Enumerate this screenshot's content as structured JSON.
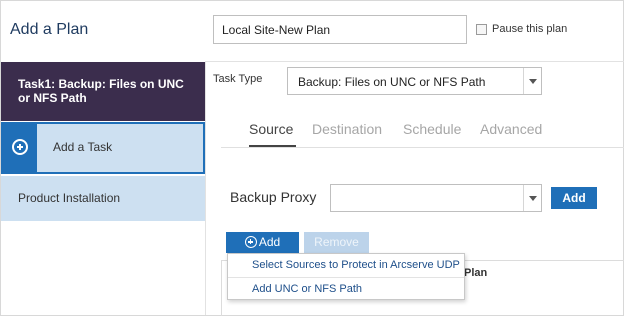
{
  "header": {
    "title": "Add a Plan",
    "plan_name_value": "Local Site-New Plan",
    "pause_label": "Pause this plan",
    "pause_checked": false
  },
  "sidebar": {
    "items": [
      {
        "label": "Task1: Backup: Files on UNC or NFS Path",
        "state": "selected"
      },
      {
        "label": "Add a Task",
        "icon": "plus-circle-icon"
      },
      {
        "label": "Product Installation"
      }
    ]
  },
  "task_type": {
    "label": "Task Type",
    "selected": "Backup: Files on UNC or NFS Path"
  },
  "tabs": [
    {
      "label": "Source",
      "active": true
    },
    {
      "label": "Destination",
      "active": false
    },
    {
      "label": "Schedule",
      "active": false
    },
    {
      "label": "Advanced",
      "active": false
    }
  ],
  "backup_proxy": {
    "label": "Backup Proxy",
    "selected": "",
    "add_label": "Add"
  },
  "source": {
    "add_label": "Add",
    "remove_label": "Remove",
    "column_plan": "Plan"
  },
  "add_menu": {
    "items": [
      "Select Sources to Protect in Arcserve UDP",
      "Add UNC or NFS Path"
    ]
  },
  "colors": {
    "accent": "#1f6fb8",
    "selected_task_bg": "#3b2d4d",
    "sidebar_bg": "#cde0f1"
  }
}
